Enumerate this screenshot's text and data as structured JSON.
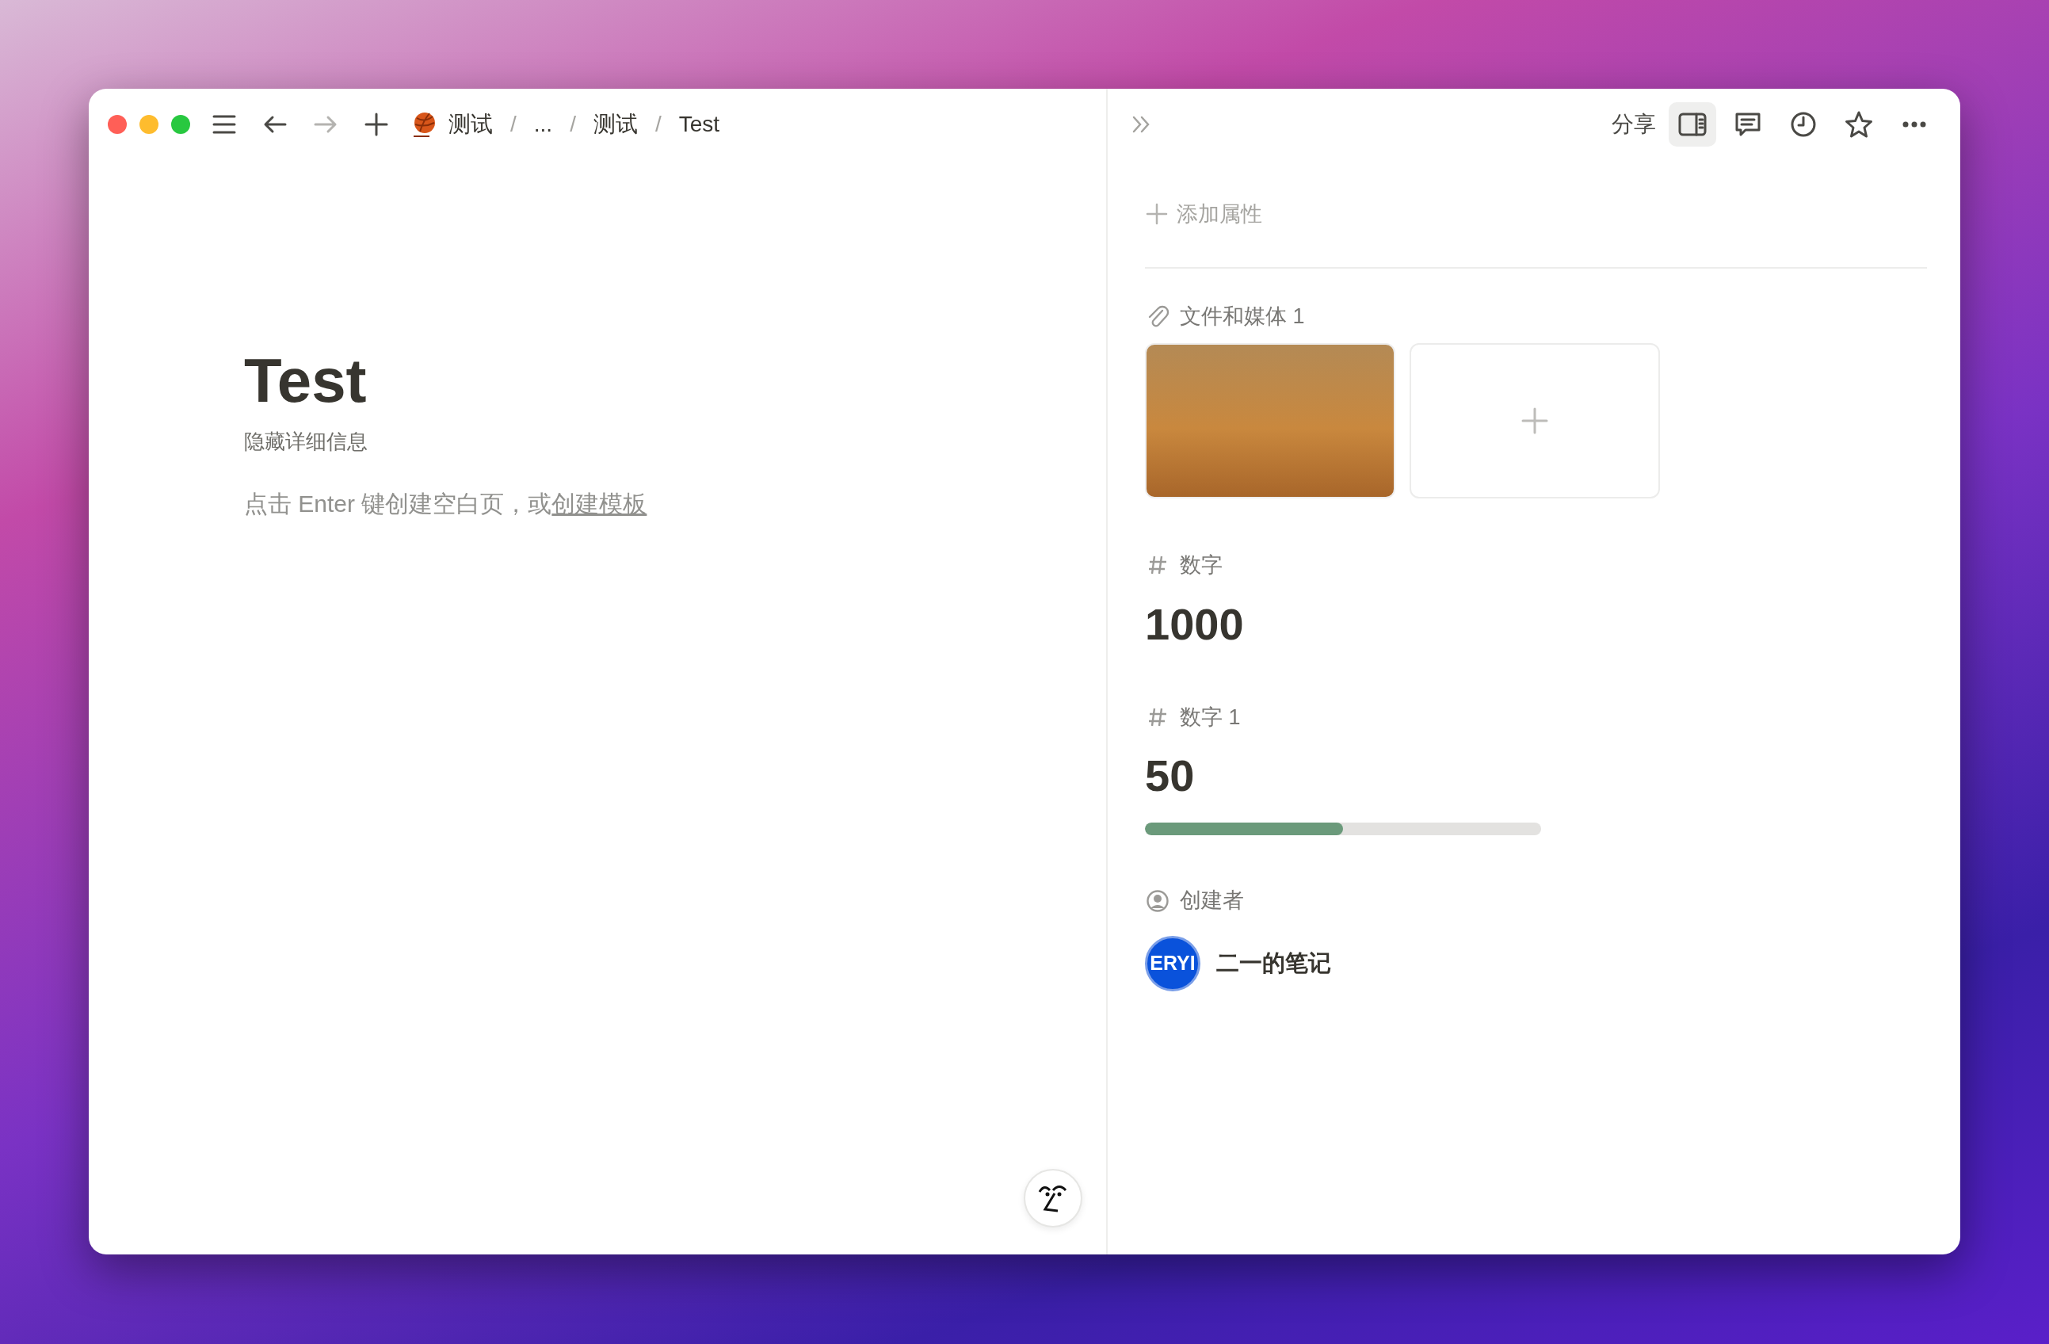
{
  "window": {
    "controls": [
      {
        "kind": "close"
      },
      {
        "kind": "minimize"
      },
      {
        "kind": "zoom"
      }
    ]
  },
  "toolbar": {
    "nav": [
      {
        "kind": "menu",
        "disabled": false
      },
      {
        "kind": "back",
        "disabled": false
      },
      {
        "kind": "forward",
        "disabled": true
      },
      {
        "kind": "new",
        "disabled": false
      }
    ],
    "breadcrumbs": [
      {
        "kind": "page",
        "text": "测试",
        "icon": true
      },
      {
        "kind": "separator",
        "text": "/"
      },
      {
        "kind": "page",
        "text": "...",
        "icon": false
      },
      {
        "kind": "separator",
        "text": "/"
      },
      {
        "kind": "page",
        "text": "测试",
        "icon": false
      },
      {
        "kind": "separator",
        "text": "/"
      },
      {
        "kind": "page",
        "text": "Test",
        "icon": false
      }
    ]
  },
  "page": {
    "title": "Test",
    "details_link": "隐藏详细信息",
    "hint": "点击 Enter 键创建空白页，或",
    "hint_link": "创建模板"
  },
  "panel": {
    "actions": [
      {
        "kind": "share",
        "text": "分享",
        "selected": false
      },
      {
        "kind": "sidebar",
        "selected": true
      },
      {
        "kind": "comments",
        "selected": false
      },
      {
        "kind": "history",
        "selected": false
      },
      {
        "kind": "favorite",
        "selected": false
      },
      {
        "kind": "more",
        "selected": false
      }
    ],
    "add_property": "添加属性",
    "properties": [
      {
        "kind": "files",
        "label": "文件和媒体 1",
        "files": [
          {
            "kind": "photo"
          }
        ]
      },
      {
        "kind": "number",
        "label": "数字",
        "value": "1000"
      },
      {
        "kind": "number_bar",
        "label": "数字 1",
        "value": "50",
        "level": 0.5
      },
      {
        "kind": "person",
        "label": "创建者",
        "avatar": "ERYI",
        "name": "二一的笔记"
      }
    ]
  }
}
